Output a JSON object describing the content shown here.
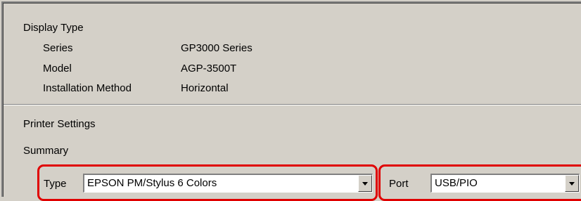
{
  "display_type": {
    "heading": "Display Type",
    "rows": [
      {
        "label": "Series",
        "value": "GP3000 Series"
      },
      {
        "label": "Model",
        "value": "AGP-3500T"
      },
      {
        "label": "Installation Method",
        "value": "Horizontal"
      }
    ]
  },
  "printer_settings": {
    "heading": "Printer Settings",
    "summary_label": "Summary",
    "type_label": "Type",
    "type_value": "EPSON PM/Stylus 6 Colors",
    "port_label": "Port",
    "port_value": "USB/PIO"
  },
  "icons": {
    "dropdown": "chevron-down-icon"
  },
  "colors": {
    "highlight": "#e00000",
    "panel": "#d4d0c8"
  }
}
